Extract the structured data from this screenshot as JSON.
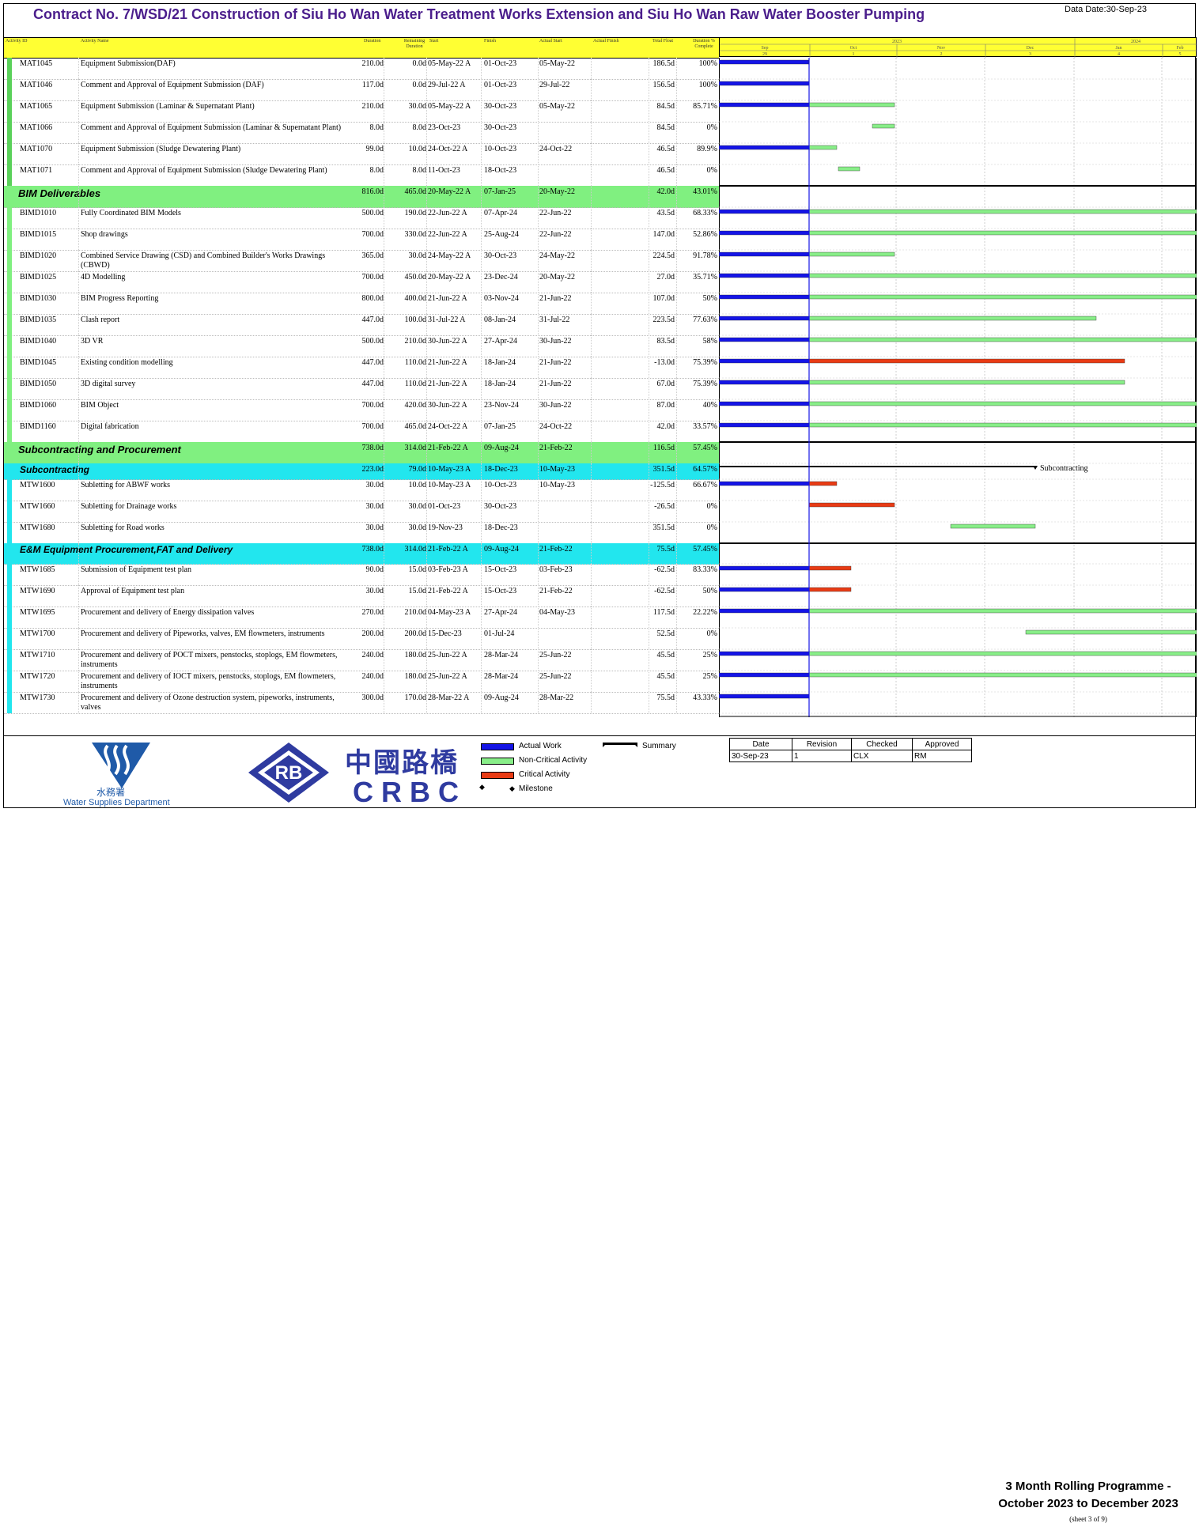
{
  "header": {
    "title": "Contract No. 7/WSD/21 Construction of Siu Ho Wan Water Treatment Works Extension and Siu Ho Wan Raw Water Booster Pumping",
    "data_date": "Data Date:30-Sep-23"
  },
  "columns": [
    "Activity ID",
    "Activity Name",
    "Duration",
    "Remaining Duration",
    "Start",
    "Finish",
    "Actual Start",
    "Actual Finish",
    "Total Float",
    "Duration % Complete"
  ],
  "timeline": {
    "years": [
      "2023",
      "2024"
    ],
    "months": [
      "Sep",
      "Oct",
      "Nov",
      "Dec",
      "Jan",
      "Feb"
    ],
    "weeks": [
      "29",
      "1",
      "2",
      "3",
      "4",
      "5"
    ]
  },
  "rows": [
    {
      "kind": "task",
      "id": "MAT1045",
      "name": "Equipment Submission(DAF)",
      "dur": "210.0d",
      "rem": "0.0d",
      "start": "05-May-22 A",
      "finish": "01-Oct-23",
      "astart": "05-May-22",
      "float": "186.5d",
      "pct": "100%",
      "h": 27,
      "lead": "#5ad15a",
      "bars": [
        {
          "t": "actual",
          "s": 0,
          "e": 114
        },
        {
          "t": "actual",
          "s": 113,
          "e": 114
        }
      ]
    },
    {
      "kind": "task",
      "id": "MAT1046",
      "name": "Comment and Approval of Equipment Submission (DAF)",
      "dur": "117.0d",
      "rem": "0.0d",
      "start": "29-Jul-22 A",
      "finish": "01-Oct-23",
      "astart": "29-Jul-22",
      "float": "156.5d",
      "pct": "100%",
      "h": 27,
      "lead": "#5ad15a",
      "bars": [
        {
          "t": "actual",
          "s": 0,
          "e": 114
        }
      ]
    },
    {
      "kind": "task",
      "id": "MAT1065",
      "name": "Equipment Submission (Laminar & Supernatant Plant)",
      "dur": "210.0d",
      "rem": "30.0d",
      "start": "05-May-22 A",
      "finish": "30-Oct-23",
      "astart": "05-May-22",
      "float": "84.5d",
      "pct": "85.71%",
      "h": 27,
      "lead": "#5ad15a",
      "bars": [
        {
          "t": "actual",
          "s": 0,
          "e": 114
        },
        {
          "t": "noncrit",
          "s": 114,
          "e": 222
        }
      ]
    },
    {
      "kind": "task",
      "id": "MAT1066",
      "name": "Comment and Approval of Equipment Submission (Laminar & Supernatant Plant)",
      "dur": "8.0d",
      "rem": "8.0d",
      "start": "23-Oct-23",
      "finish": "30-Oct-23",
      "astart": "",
      "float": "84.5d",
      "pct": "0%",
      "h": 27,
      "lead": "#5ad15a",
      "bars": [
        {
          "t": "noncrit",
          "s": 194,
          "e": 222
        }
      ]
    },
    {
      "kind": "task",
      "id": "MAT1070",
      "name": "Equipment Submission (Sludge Dewatering Plant)",
      "dur": "99.0d",
      "rem": "10.0d",
      "start": "24-Oct-22 A",
      "finish": "10-Oct-23",
      "astart": "24-Oct-22",
      "float": "46.5d",
      "pct": "89.9%",
      "h": 27,
      "lead": "#5ad15a",
      "bars": [
        {
          "t": "actual",
          "s": 0,
          "e": 114
        },
        {
          "t": "noncrit",
          "s": 114,
          "e": 149
        }
      ]
    },
    {
      "kind": "task",
      "id": "MAT1071",
      "name": "Comment and Approval of Equipment Submission (Sludge Dewatering Plant)",
      "dur": "8.0d",
      "rem": "8.0d",
      "start": "11-Oct-23",
      "finish": "18-Oct-23",
      "astart": "",
      "float": "46.5d",
      "pct": "0%",
      "h": 27,
      "lead": "#5ad15a",
      "bars": [
        {
          "t": "noncrit",
          "s": 151,
          "e": 178
        }
      ]
    },
    {
      "kind": "wbs",
      "id": "",
      "name": "BIM Deliverables",
      "dur": "816.0d",
      "rem": "465.0d",
      "start": "20-May-22 A",
      "finish": "07-Jan-25",
      "astart": "20-May-22",
      "float": "42.0d",
      "pct": "43.01%",
      "h": 27,
      "bg": "#80f080",
      "bars": []
    },
    {
      "kind": "task",
      "id": "BIMD1010",
      "name": "Fully Coordinated BIM Models",
      "dur": "500.0d",
      "rem": "190.0d",
      "start": "22-Jun-22 A",
      "finish": "07-Apr-24",
      "astart": "22-Jun-22",
      "float": "43.5d",
      "pct": "68.33%",
      "h": 27,
      "lead": "#80f080",
      "bars": [
        {
          "t": "actual",
          "s": 0,
          "e": 114
        },
        {
          "t": "noncrit",
          "s": 114,
          "e": 604
        }
      ]
    },
    {
      "kind": "task",
      "id": "BIMD1015",
      "name": "Shop drawings",
      "dur": "700.0d",
      "rem": "330.0d",
      "start": "22-Jun-22 A",
      "finish": "25-Aug-24",
      "astart": "22-Jun-22",
      "float": "147.0d",
      "pct": "52.86%",
      "h": 27,
      "lead": "#80f080",
      "bars": [
        {
          "t": "actual",
          "s": 0,
          "e": 114
        },
        {
          "t": "noncrit",
          "s": 114,
          "e": 604
        }
      ]
    },
    {
      "kind": "task",
      "id": "BIMD1020",
      "name": "Combined Service Drawing (CSD) and Combined Builder's Works Drawings (CBWD)",
      "dur": "365.0d",
      "rem": "30.0d",
      "start": "24-May-22 A",
      "finish": "30-Oct-23",
      "astart": "24-May-22",
      "float": "224.5d",
      "pct": "91.78%",
      "h": 27,
      "lead": "#80f080",
      "bars": [
        {
          "t": "actual",
          "s": 0,
          "e": 114
        },
        {
          "t": "noncrit",
          "s": 114,
          "e": 222
        }
      ]
    },
    {
      "kind": "task",
      "id": "BIMD1025",
      "name": "4D Modelling",
      "dur": "700.0d",
      "rem": "450.0d",
      "start": "20-May-22 A",
      "finish": "23-Dec-24",
      "astart": "20-May-22",
      "float": "27.0d",
      "pct": "35.71%",
      "h": 27,
      "lead": "#80f080",
      "bars": [
        {
          "t": "actual",
          "s": 0,
          "e": 114
        },
        {
          "t": "noncrit",
          "s": 114,
          "e": 604
        }
      ]
    },
    {
      "kind": "task",
      "id": "BIMD1030",
      "name": "BIM Progress Reporting",
      "dur": "800.0d",
      "rem": "400.0d",
      "start": "21-Jun-22 A",
      "finish": "03-Nov-24",
      "astart": "21-Jun-22",
      "float": "107.0d",
      "pct": "50%",
      "h": 27,
      "lead": "#80f080",
      "bars": [
        {
          "t": "actual",
          "s": 0,
          "e": 114
        },
        {
          "t": "noncrit",
          "s": 114,
          "e": 604
        }
      ]
    },
    {
      "kind": "task",
      "id": "BIMD1035",
      "name": "Clash report",
      "dur": "447.0d",
      "rem": "100.0d",
      "start": "31-Jul-22 A",
      "finish": "08-Jan-24",
      "astart": "31-Jul-22",
      "float": "223.5d",
      "pct": "77.63%",
      "h": 27,
      "lead": "#80f080",
      "bars": [
        {
          "t": "actual",
          "s": 0,
          "e": 114
        },
        {
          "t": "noncrit",
          "s": 114,
          "e": 477
        }
      ]
    },
    {
      "kind": "task",
      "id": "BIMD1040",
      "name": "3D VR",
      "dur": "500.0d",
      "rem": "210.0d",
      "start": "30-Jun-22 A",
      "finish": "27-Apr-24",
      "astart": "30-Jun-22",
      "float": "83.5d",
      "pct": "58%",
      "h": 27,
      "lead": "#80f080",
      "bars": [
        {
          "t": "actual",
          "s": 0,
          "e": 114
        },
        {
          "t": "noncrit",
          "s": 114,
          "e": 604
        }
      ]
    },
    {
      "kind": "task",
      "id": "BIMD1045",
      "name": "Existing condition modelling",
      "dur": "447.0d",
      "rem": "110.0d",
      "start": "21-Jun-22 A",
      "finish": "18-Jan-24",
      "astart": "21-Jun-22",
      "float": "-13.0d",
      "pct": "75.39%",
      "h": 27,
      "lead": "#80f080",
      "bars": [
        {
          "t": "actual",
          "s": 0,
          "e": 114
        },
        {
          "t": "crit",
          "s": 114,
          "e": 513
        }
      ]
    },
    {
      "kind": "task",
      "id": "BIMD1050",
      "name": "3D digital survey",
      "dur": "447.0d",
      "rem": "110.0d",
      "start": "21-Jun-22 A",
      "finish": "18-Jan-24",
      "astart": "21-Jun-22",
      "float": "67.0d",
      "pct": "75.39%",
      "h": 27,
      "lead": "#80f080",
      "bars": [
        {
          "t": "actual",
          "s": 0,
          "e": 114
        },
        {
          "t": "noncrit",
          "s": 114,
          "e": 513
        }
      ]
    },
    {
      "kind": "task",
      "id": "BIMD1060",
      "name": "BIM Object",
      "dur": "700.0d",
      "rem": "420.0d",
      "start": "30-Jun-22 A",
      "finish": "23-Nov-24",
      "astart": "30-Jun-22",
      "float": "87.0d",
      "pct": "40%",
      "h": 27,
      "lead": "#80f080",
      "bars": [
        {
          "t": "actual",
          "s": 0,
          "e": 114
        },
        {
          "t": "noncrit",
          "s": 114,
          "e": 604
        }
      ]
    },
    {
      "kind": "task",
      "id": "BIMD1160",
      "name": "Digital fabrication",
      "dur": "700.0d",
      "rem": "465.0d",
      "start": "24-Oct-22 A",
      "finish": "07-Jan-25",
      "astart": "24-Oct-22",
      "float": "42.0d",
      "pct": "33.57%",
      "h": 27,
      "lead": "#80f080",
      "bars": [
        {
          "t": "actual",
          "s": 0,
          "e": 114
        },
        {
          "t": "noncrit",
          "s": 114,
          "e": 604
        }
      ]
    },
    {
      "kind": "wbs",
      "id": "",
      "name": "Subcontracting and Procurement",
      "dur": "738.0d",
      "rem": "314.0d",
      "start": "21-Feb-22 A",
      "finish": "09-Aug-24",
      "astart": "21-Feb-22",
      "float": "116.5d",
      "pct": "57.45%",
      "h": 27,
      "bg": "#80f080",
      "bars": []
    },
    {
      "kind": "wbs2",
      "id": "",
      "name": "Subcontracting",
      "dur": "223.0d",
      "rem": "79.0d",
      "start": "10-May-23 A",
      "finish": "18-Dec-23",
      "astart": "10-May-23",
      "float": "351.5d",
      "pct": "64.57%",
      "h": 20,
      "bg": "#22e6ee",
      "bars": [
        {
          "t": "summary",
          "s": 0,
          "e": 400
        }
      ]
    },
    {
      "kind": "task",
      "id": "MTW1600",
      "name": "Subletting for ABWF works",
      "dur": "30.0d",
      "rem": "10.0d",
      "start": "10-May-23 A",
      "finish": "10-Oct-23",
      "astart": "10-May-23",
      "float": "-125.5d",
      "pct": "66.67%",
      "h": 27,
      "lead": "#22e6ee",
      "bars": [
        {
          "t": "actual",
          "s": 0,
          "e": 114
        },
        {
          "t": "crit",
          "s": 114,
          "e": 149
        }
      ]
    },
    {
      "kind": "task",
      "id": "MTW1660",
      "name": "Subletting for Drainage works",
      "dur": "30.0d",
      "rem": "30.0d",
      "start": "01-Oct-23",
      "finish": "30-Oct-23",
      "astart": "",
      "float": "-26.5d",
      "pct": "0%",
      "h": 27,
      "lead": "#22e6ee",
      "bars": [
        {
          "t": "crit",
          "s": 114,
          "e": 222
        }
      ]
    },
    {
      "kind": "task",
      "id": "MTW1680",
      "name": "Subletting for Road works",
      "dur": "30.0d",
      "rem": "30.0d",
      "start": "19-Nov-23",
      "finish": "18-Dec-23",
      "astart": "",
      "float": "351.5d",
      "pct": "0%",
      "h": 27,
      "lead": "#22e6ee",
      "bars": [
        {
          "t": "noncrit",
          "s": 293,
          "e": 400
        }
      ]
    },
    {
      "kind": "wbs2",
      "id": "",
      "name": "E&M Equipment Procurement,FAT and Delivery",
      "dur": "738.0d",
      "rem": "314.0d",
      "start": "21-Feb-22 A",
      "finish": "09-Aug-24",
      "astart": "21-Feb-22",
      "float": "75.5d",
      "pct": "57.45%",
      "h": 26,
      "bg": "#22e6ee",
      "bars": []
    },
    {
      "kind": "task",
      "id": "MTW1685",
      "name": "Submission of Equipment test plan",
      "dur": "90.0d",
      "rem": "15.0d",
      "start": "03-Feb-23 A",
      "finish": "15-Oct-23",
      "astart": "03-Feb-23",
      "float": "-62.5d",
      "pct": "83.33%",
      "h": 27,
      "lead": "#22e6ee",
      "bars": [
        {
          "t": "actual",
          "s": 0,
          "e": 114
        },
        {
          "t": "crit",
          "s": 114,
          "e": 167
        }
      ]
    },
    {
      "kind": "task",
      "id": "MTW1690",
      "name": "Approval of Equipment test plan",
      "dur": "30.0d",
      "rem": "15.0d",
      "start": "21-Feb-22 A",
      "finish": "15-Oct-23",
      "astart": "21-Feb-22",
      "float": "-62.5d",
      "pct": "50%",
      "h": 27,
      "lead": "#22e6ee",
      "bars": [
        {
          "t": "actual",
          "s": 0,
          "e": 114
        },
        {
          "t": "crit",
          "s": 114,
          "e": 167
        }
      ]
    },
    {
      "kind": "task",
      "id": "MTW1695",
      "name": "Procurement and delivery of Energy dissipation valves",
      "dur": "270.0d",
      "rem": "210.0d",
      "start": "04-May-23 A",
      "finish": "27-Apr-24",
      "astart": "04-May-23",
      "float": "117.5d",
      "pct": "22.22%",
      "h": 27,
      "lead": "#22e6ee",
      "bars": [
        {
          "t": "actual",
          "s": 0,
          "e": 114
        },
        {
          "t": "noncrit",
          "s": 114,
          "e": 604
        }
      ]
    },
    {
      "kind": "task",
      "id": "MTW1700",
      "name": "Procurement and delivery of Pipeworks, valves, EM flowmeters, instruments",
      "dur": "200.0d",
      "rem": "200.0d",
      "start": "15-Dec-23",
      "finish": "01-Jul-24",
      "astart": "",
      "float": "52.5d",
      "pct": "0%",
      "h": 27,
      "lead": "#22e6ee",
      "bars": [
        {
          "t": "noncrit",
          "s": 388,
          "e": 604
        }
      ]
    },
    {
      "kind": "task",
      "id": "MTW1710",
      "name": "Procurement and delivery of POCT mixers, penstocks, stoplogs, EM flowmeters, instruments",
      "dur": "240.0d",
      "rem": "180.0d",
      "start": "25-Jun-22 A",
      "finish": "28-Mar-24",
      "astart": "25-Jun-22",
      "float": "45.5d",
      "pct": "25%",
      "h": 27,
      "lead": "#22e6ee",
      "bars": [
        {
          "t": "actual",
          "s": 0,
          "e": 114
        },
        {
          "t": "noncrit",
          "s": 114,
          "e": 604
        }
      ]
    },
    {
      "kind": "task",
      "id": "MTW1720",
      "name": "Procurement and delivery of IOCT mixers, penstocks, stoplogs, EM flowmeters, instruments",
      "dur": "240.0d",
      "rem": "180.0d",
      "start": "25-Jun-22 A",
      "finish": "28-Mar-24",
      "astart": "25-Jun-22",
      "float": "45.5d",
      "pct": "25%",
      "h": 27,
      "lead": "#22e6ee",
      "bars": [
        {
          "t": "actual",
          "s": 0,
          "e": 114
        },
        {
          "t": "noncrit",
          "s": 114,
          "e": 604
        }
      ]
    },
    {
      "kind": "task",
      "id": "MTW1730",
      "name": "Procurement and delivery of Ozone destruction system, pipeworks, instruments, valves",
      "dur": "300.0d",
      "rem": "170.0d",
      "start": "28-Mar-22 A",
      "finish": "09-Aug-24",
      "astart": "28-Mar-22",
      "float": "75.5d",
      "pct": "43.33%",
      "h": 27,
      "lead": "#22e6ee",
      "bars": [
        {
          "t": "actual",
          "s": 0,
          "e": 114
        }
      ]
    }
  ],
  "summary_label": "Subcontracting",
  "legend": {
    "actual": "Actual Work",
    "noncrit": "Non-Critical Activity",
    "crit": "Critical Activity",
    "milestone": "Milestone",
    "summary": "Summary",
    "colors": {
      "actual": "#1414e6",
      "noncrit": "#88ee88",
      "crit": "#e83b14",
      "summary": "#000000"
    }
  },
  "revision_table": {
    "headers": [
      "Date",
      "Revision",
      "Checked",
      "Approved"
    ],
    "values": [
      "30-Sep-23",
      "1",
      "CLX",
      "RM"
    ]
  },
  "logos": {
    "wsd_chinese": "水務署",
    "wsd_english": "Water Supplies Department",
    "rb": "RB",
    "crbc_chinese": "中國路橋",
    "crbc_english": "CRBC"
  },
  "programme": {
    "line1": "3 Month Rolling Programme -",
    "line2": "October 2023 to December 2023",
    "sheet": "(sheet 3 of 9)"
  }
}
